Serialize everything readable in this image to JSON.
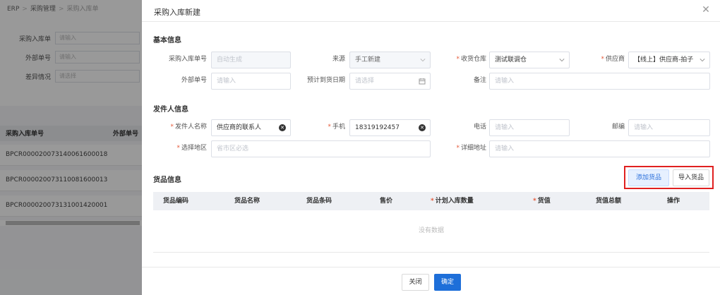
{
  "background": {
    "breadcrumb": [
      "ERP",
      "采购管理",
      "采购入库单"
    ],
    "filters": [
      {
        "label": "采购入库单",
        "placeholder": "请输入"
      },
      {
        "label": "外部单号",
        "placeholder": "请输入"
      },
      {
        "label": "差异情况",
        "placeholder": "请选择"
      }
    ],
    "table_headers": [
      "采购入库单号",
      "外部单号"
    ],
    "rows": [
      "BPCR000020073140061600018",
      "BPCR000020073110081600013",
      "BPCR000020073131001420001"
    ]
  },
  "drawer": {
    "title": "采购入库新建",
    "close_icon": "close-icon",
    "basic_section": "基本信息",
    "basic": {
      "order_no_label": "采购入库单号",
      "order_no_value": "自动生成",
      "source_label": "来源",
      "source_value": "手工新建",
      "warehouse_label": "收货仓库",
      "warehouse_value": "测试联调仓",
      "supplier_label": "供应商",
      "supplier_value": "【线上】供应商-拍子",
      "external_label": "外部单号",
      "external_placeholder": "请输入",
      "eta_label": "预计到货日期",
      "eta_placeholder": "请选择",
      "remark_label": "备注",
      "remark_placeholder": "请输入"
    },
    "sender_section": "发件人信息",
    "sender": {
      "name_label": "发件人名称",
      "name_value": "供应商的联系人",
      "mobile_label": "手机",
      "mobile_value": "18319192457",
      "phone_label": "电话",
      "phone_placeholder": "请输入",
      "zip_label": "邮编",
      "zip_placeholder": "请输入",
      "region_label": "选择地区",
      "region_placeholder": "省市区必选",
      "address_label": "详细地址",
      "address_placeholder": "请输入"
    },
    "goods_section": "货品信息",
    "add_goods_button": "添加货品",
    "import_goods_button": "导入货品",
    "goods_table": {
      "headers": [
        "货品编码",
        "货品名称",
        "货品条码",
        "售价",
        "计划入库数量",
        "货值",
        "货值总额",
        "操作"
      ],
      "empty_text": "没有数据"
    },
    "close_button": "关闭",
    "confirm_button": "确定"
  }
}
